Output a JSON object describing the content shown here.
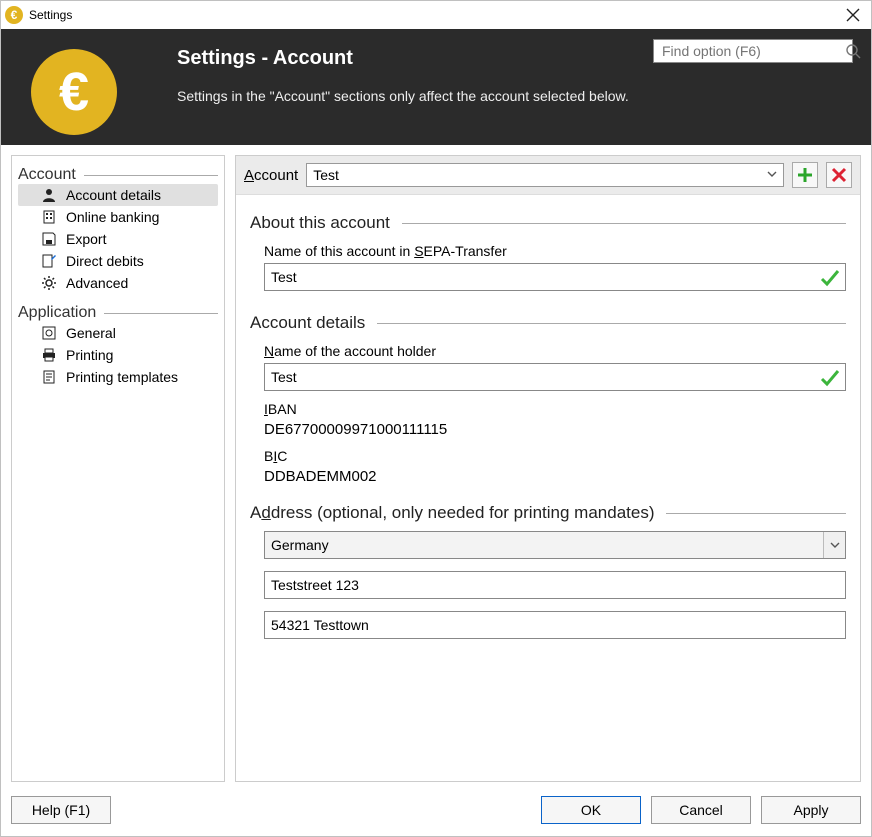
{
  "window": {
    "title": "Settings"
  },
  "header": {
    "title": "Settings - Account",
    "subtitle": "Settings in the \"Account\" sections only affect the account selected below.",
    "search_placeholder": "Find option (F6)"
  },
  "sidebar": {
    "group1_label": "Account",
    "items1": [
      {
        "label": "Account details"
      },
      {
        "label": "Online banking"
      },
      {
        "label": "Export"
      },
      {
        "label": "Direct debits"
      },
      {
        "label": "Advanced"
      }
    ],
    "group2_label": "Application",
    "items2": [
      {
        "label": "General"
      },
      {
        "label": "Printing"
      },
      {
        "label": "Printing templates"
      }
    ]
  },
  "account_row": {
    "label": "Account",
    "selected": "Test"
  },
  "sections": {
    "about": {
      "title": "About this account",
      "name_label_pre": "Name of this account in ",
      "name_label_u": "S",
      "name_label_post": "EPA-Transfer",
      "name_value": "Test"
    },
    "details": {
      "title": "Account details",
      "holder_label_u": "N",
      "holder_label_post": "ame of the account holder",
      "holder_value": "Test",
      "iban_label_u": "I",
      "iban_label_post": "BAN",
      "iban_value": "DE67700009971000111115",
      "bic_label_pre": "B",
      "bic_label_u": "I",
      "bic_label_post": "C",
      "bic_value": "DDBADEMM002"
    },
    "address": {
      "title_pre": "A",
      "title_u": "d",
      "title_post": "dress (optional, only needed for printing mandates)",
      "country": "Germany",
      "street": "Teststreet 123",
      "city": "54321 Testtown"
    }
  },
  "footer": {
    "help": "Help (F1)",
    "ok": "OK",
    "cancel": "Cancel",
    "apply": "Apply"
  }
}
